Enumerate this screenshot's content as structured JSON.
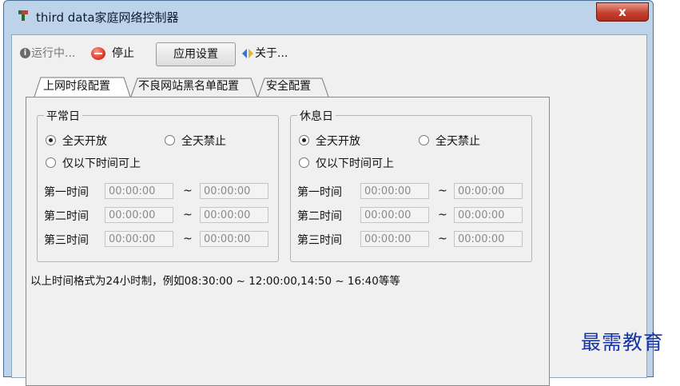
{
  "window": {
    "title": "third data家庭网络控制器",
    "close_label": "x"
  },
  "toolbar": {
    "running_label": "运行中...",
    "stop_label": "停止",
    "apply_label": "应用设置",
    "about_label": "关于..."
  },
  "tabs": [
    {
      "label": "上网时段配置",
      "active": true
    },
    {
      "label": "不良网站黑名单配置",
      "active": false
    },
    {
      "label": "安全配置",
      "active": false
    }
  ],
  "weekday": {
    "title": "平常日",
    "options": [
      {
        "label": "全天开放",
        "checked": true
      },
      {
        "label": "全天禁止",
        "checked": false
      },
      {
        "label": "仅以下时间可上",
        "checked": false
      }
    ],
    "rows": [
      {
        "label": "第一时间",
        "start": "00:00:00",
        "separator": "~",
        "end": "00:00:00"
      },
      {
        "label": "第二时间",
        "start": "00:00:00",
        "separator": "~",
        "end": "00:00:00"
      },
      {
        "label": "第三时间",
        "start": "00:00:00",
        "separator": "~",
        "end": "00:00:00"
      }
    ]
  },
  "holiday": {
    "title": "休息日",
    "options": [
      {
        "label": "全天开放",
        "checked": true
      },
      {
        "label": "全天禁止",
        "checked": false
      },
      {
        "label": "仅以下时间可上",
        "checked": false
      }
    ],
    "rows": [
      {
        "label": "第一时间",
        "start": "00:00:00",
        "separator": "~",
        "end": "00:00:00"
      },
      {
        "label": "第二时间",
        "start": "00:00:00",
        "separator": "~",
        "end": "00:00:00"
      },
      {
        "label": "第三时间",
        "start": "00:00:00",
        "separator": "~",
        "end": "00:00:00"
      }
    ]
  },
  "note": "以上时间格式为24小时制，例如08:30:00 ~ 12:00:00,14:50 ~ 16:40等等",
  "watermark": "最需教育",
  "colors": {
    "frame": "#bcd3ea",
    "close_button": "#c4412f",
    "watermark": "#1733a8"
  }
}
